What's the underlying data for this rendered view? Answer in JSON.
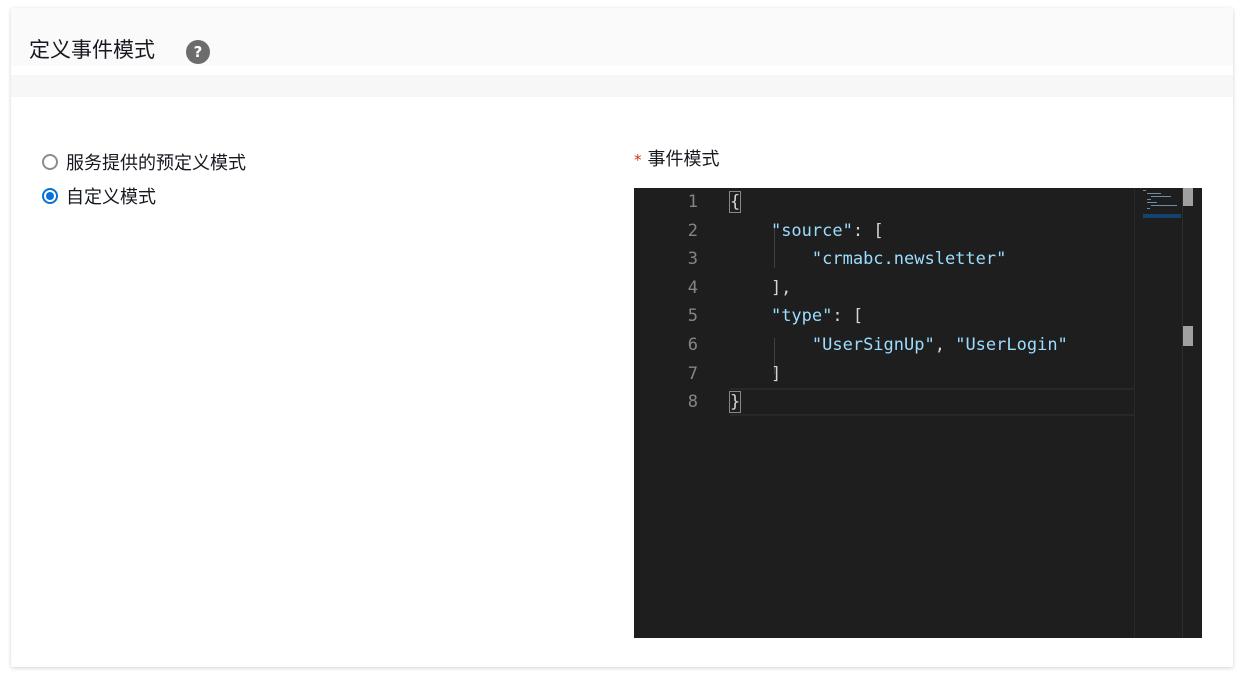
{
  "header": {
    "title": "定义事件模式",
    "help_icon": "help-icon",
    "help_glyph": "?"
  },
  "pattern_source": {
    "options": [
      {
        "label": "服务提供的预定义模式",
        "selected": false
      },
      {
        "label": "自定义模式",
        "selected": true
      }
    ]
  },
  "event_pattern": {
    "required_mark": "*",
    "label": "事件模式",
    "line_numbers": [
      "1",
      "2",
      "3",
      "4",
      "5",
      "6",
      "7",
      "8"
    ],
    "code_lines": [
      "{",
      "    \"source\": [",
      "        \"crmabc.newsletter\"",
      "    ],",
      "    \"type\": [",
      "        \"UserSignUp\", \"UserLogin\"",
      "    ]",
      "}"
    ]
  },
  "colors": {
    "accent": "#0972d3",
    "editor_bg": "#1e1e1e",
    "json_string": "#9cdcfe",
    "required": "#d13212"
  }
}
